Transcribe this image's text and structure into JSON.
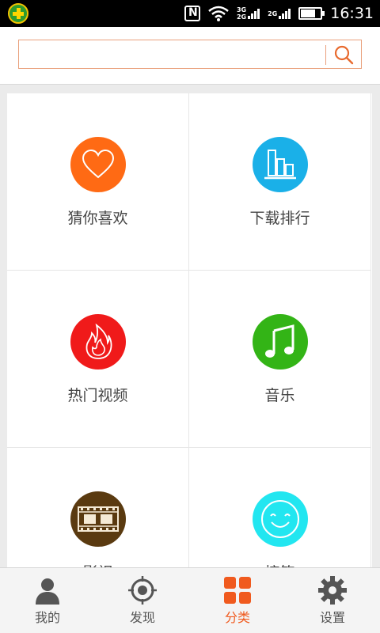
{
  "status_bar": {
    "time": "16:31",
    "network_top": "3G",
    "network_bottom": "2G",
    "network_2": "2G",
    "icons": [
      "app-icon",
      "nfc-icon",
      "wifi-icon",
      "signal-icon",
      "battery-icon"
    ]
  },
  "search": {
    "value": "",
    "placeholder": "",
    "accent_color": "#e9a07c"
  },
  "categories": [
    {
      "label": "猜你喜欢",
      "icon": "heart-icon",
      "color": "#ff6a14"
    },
    {
      "label": "下载排行",
      "icon": "bar-chart-icon",
      "color": "#1ab0e8"
    },
    {
      "label": "热门视频",
      "icon": "fire-icon",
      "color": "#f01a1a"
    },
    {
      "label": "音乐",
      "icon": "music-note-icon",
      "color": "#33b416"
    },
    {
      "label": "影视",
      "icon": "film-icon",
      "color": "#5a3a10"
    },
    {
      "label": "搞笑",
      "icon": "smiley-icon",
      "color": "#22e6f0"
    }
  ],
  "tabs": [
    {
      "label": "我的",
      "icon": "user-icon",
      "active": false
    },
    {
      "label": "发现",
      "icon": "compass-icon",
      "active": false
    },
    {
      "label": "分类",
      "icon": "grid-icon",
      "active": true
    },
    {
      "label": "设置",
      "icon": "gear-icon",
      "active": false
    }
  ],
  "active_color": "#f05a1e"
}
